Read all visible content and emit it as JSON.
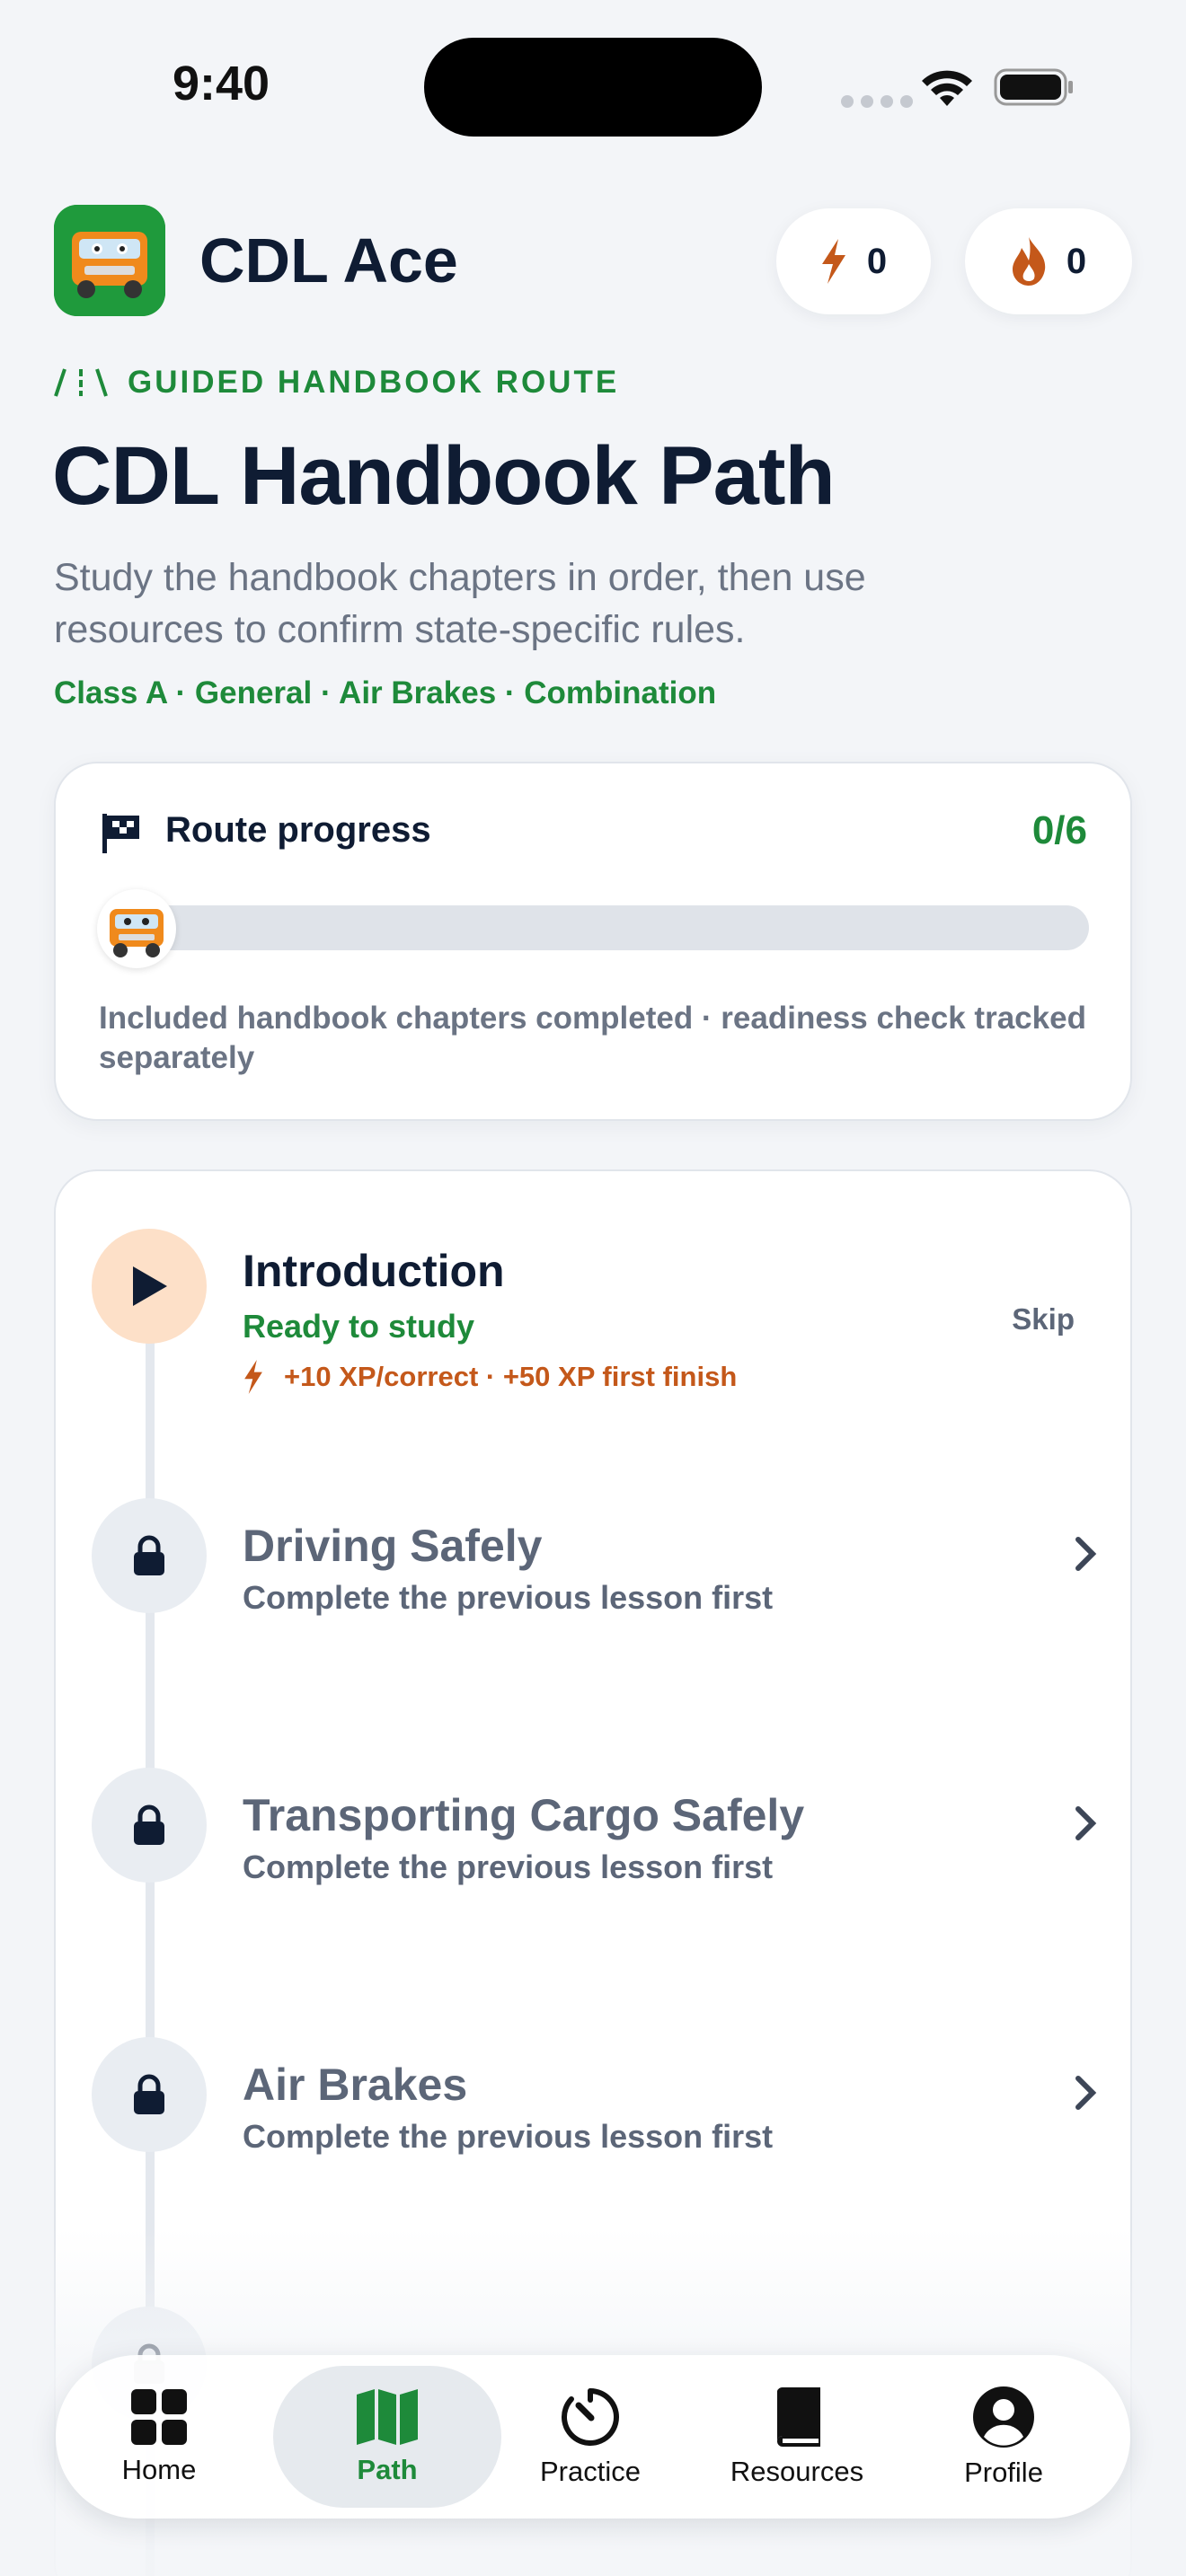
{
  "status": {
    "time": "9:40"
  },
  "app": {
    "title": "CDL Ace",
    "xp_count": "0",
    "streak_count": "0"
  },
  "hero": {
    "tag": "GUIDED HANDBOOK ROUTE",
    "title": "CDL Handbook Path",
    "subtitle": "Study the handbook chapters in order, then use resources to confirm state-specific rules.",
    "classes": "Class A · General · Air Brakes · Combination"
  },
  "progress": {
    "title": "Route progress",
    "count": "0/6",
    "fraction": 0,
    "note": "Included handbook chapters completed · readiness check tracked separately"
  },
  "lessons": [
    {
      "title": "Introduction",
      "status": "Ready to study",
      "xp": "+10 XP/correct · +50 XP first finish",
      "action": "Skip",
      "state": "active"
    },
    {
      "title": "Driving Safely",
      "status": "Complete the previous lesson first",
      "state": "locked"
    },
    {
      "title": "Transporting Cargo Safely",
      "status": "Complete the previous lesson first",
      "state": "locked"
    },
    {
      "title": "Air Brakes",
      "status": "Complete the previous lesson first",
      "state": "locked"
    }
  ],
  "tabs": [
    {
      "label": "Home",
      "icon": "grid-icon"
    },
    {
      "label": "Path",
      "icon": "map-icon",
      "active": true
    },
    {
      "label": "Practice",
      "icon": "timer-icon"
    },
    {
      "label": "Resources",
      "icon": "book-icon"
    },
    {
      "label": "Profile",
      "icon": "person-icon"
    }
  ],
  "colors": {
    "accent_green": "#1e8a3a",
    "xp_orange": "#c4581a",
    "text_dark": "#0f1c33",
    "text_muted": "#6b7484"
  }
}
